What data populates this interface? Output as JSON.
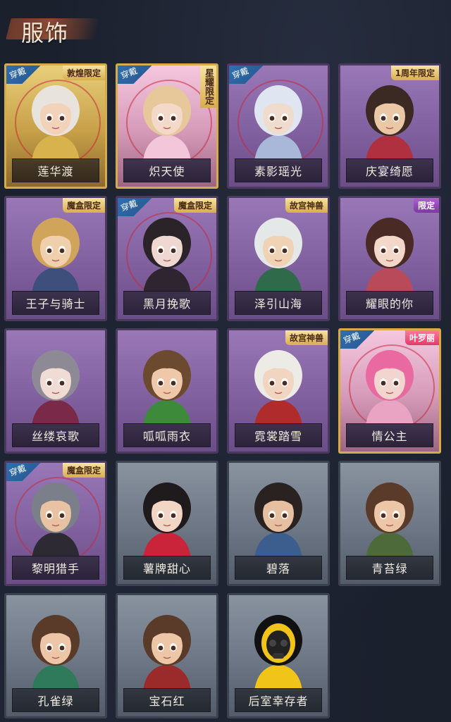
{
  "header": {
    "title": "服饰"
  },
  "wear_label": "穿戴",
  "colors": {
    "background": "#1b202d",
    "title_brush": "#8a4a33",
    "wear_tag": "#2f6fb0",
    "selected_ring": "#c8283c"
  },
  "items": [
    {
      "name": "莲华渡",
      "frame": "gold",
      "worn": true,
      "badge": "敦煌限定",
      "badge_style": "gold",
      "hair": "#e8e3dd",
      "skin": "#f2d2b8",
      "outfit": "#d8b24c"
    },
    {
      "name": "炽天使",
      "frame": "pinkgold",
      "worn": true,
      "badge": "星耀限定",
      "badge_style": "gold-vertical",
      "hair": "#e7c89a",
      "skin": "#f4d8c8",
      "outfit": "#f3c6d9"
    },
    {
      "name": "素影瑶光",
      "frame": "purple",
      "worn": true,
      "badge": "",
      "badge_style": "",
      "hair": "#dfe6f2",
      "skin": "#f0dccd",
      "outfit": "#a9b7d8"
    },
    {
      "name": "庆宴绮愿",
      "frame": "purple",
      "worn": false,
      "badge": "1周年限定",
      "badge_style": "gold",
      "hair": "#3b2a24",
      "skin": "#eac7a5",
      "outfit": "#b03040"
    },
    {
      "name": "王子与骑士",
      "frame": "purple",
      "worn": false,
      "badge": "魔盒限定",
      "badge_style": "gold",
      "hair": "#d0a45a",
      "skin": "#f0cfac",
      "outfit": "#3d4f7a"
    },
    {
      "name": "黑月挽歌",
      "frame": "purple",
      "worn": true,
      "badge": "魔盒限定",
      "badge_style": "gold",
      "hair": "#2a2328",
      "skin": "#efd8d2",
      "outfit": "#2f2530"
    },
    {
      "name": "泽引山海",
      "frame": "purple",
      "worn": false,
      "badge": "故宫神兽",
      "badge_style": "gold",
      "hair": "#e4e8e6",
      "skin": "#f0d3b4",
      "outfit": "#2f6b4a"
    },
    {
      "name": "耀眼的你",
      "frame": "purple",
      "worn": false,
      "badge": "限定",
      "badge_style": "purple",
      "hair": "#4a2a24",
      "skin": "#f3d7c8",
      "outfit": "#b84a5a"
    },
    {
      "name": "丝缕哀歌",
      "frame": "purple",
      "worn": false,
      "badge": "",
      "badge_style": "",
      "hair": "#8d8a95",
      "skin": "#f0dcd4",
      "outfit": "#7a2a48"
    },
    {
      "name": "呱呱雨衣",
      "frame": "purple",
      "worn": false,
      "badge": "",
      "badge_style": "",
      "hair": "#6b4a30",
      "skin": "#eec8a8",
      "outfit": "#3d8a3a"
    },
    {
      "name": "霓裳踏雪",
      "frame": "purple",
      "worn": false,
      "badge": "故宫神兽",
      "badge_style": "gold",
      "hair": "#ecebe6",
      "skin": "#f1d5c0",
      "outfit": "#b02c2c"
    },
    {
      "name": "情公主",
      "frame": "pinkgold",
      "worn": true,
      "badge": "叶罗丽",
      "badge_style": "red",
      "hair": "#e86aa0",
      "skin": "#f3d5cf",
      "outfit": "#e9a4c4"
    },
    {
      "name": "黎明猎手",
      "frame": "purple",
      "worn": true,
      "badge": "魔盒限定",
      "badge_style": "gold",
      "hair": "#7b7f8a",
      "skin": "#e8c3a3",
      "outfit": "#2d2a33"
    },
    {
      "name": "薯牌甜心",
      "frame": "grey",
      "worn": false,
      "badge": "",
      "badge_style": "",
      "hair": "#1f1a1c",
      "skin": "#f1d6c6",
      "outfit": "#c9243a"
    },
    {
      "name": "碧落",
      "frame": "grey",
      "worn": false,
      "badge": "",
      "badge_style": "",
      "hair": "#2a2220",
      "skin": "#e7c0a2",
      "outfit": "#3b5e8f"
    },
    {
      "name": "青苔绿",
      "frame": "grey",
      "worn": false,
      "badge": "",
      "badge_style": "",
      "hair": "#5a3a28",
      "skin": "#ecc6a6",
      "outfit": "#4c6a3a"
    },
    {
      "name": "孔雀绿",
      "frame": "grey",
      "worn": false,
      "badge": "",
      "badge_style": "",
      "hair": "#5a3a28",
      "skin": "#ecc6a6",
      "outfit": "#2f7a5a"
    },
    {
      "name": "宝石红",
      "frame": "grey",
      "worn": false,
      "badge": "",
      "badge_style": "",
      "hair": "#5a3a28",
      "skin": "#ecc6a6",
      "outfit": "#9b2a2a"
    },
    {
      "name": "后室幸存者",
      "frame": "grey",
      "worn": false,
      "badge": "",
      "badge_style": "",
      "hair": "#111111",
      "skin": "#222222",
      "outfit": "#f0c419",
      "masked": true
    }
  ]
}
